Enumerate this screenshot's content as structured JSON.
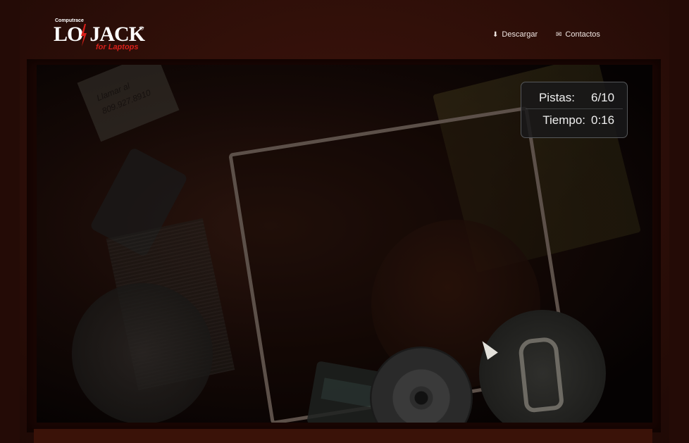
{
  "logo": {
    "small": "Computrace",
    "big_left": "LO",
    "big_right": "JACK",
    "subtitle": "for Laptops"
  },
  "nav": {
    "download": {
      "icon": "download-arrow-icon",
      "label": "Descargar"
    },
    "contact": {
      "icon": "envelope-icon",
      "label": "Contactos"
    }
  },
  "hud": {
    "clues_label": "Pistas:",
    "clues_value": "6/10",
    "time_label": "Tiempo:",
    "time_value": "0:16"
  },
  "scene": {
    "note_line1": "Llamar al",
    "note_line2": "809.927.8910"
  },
  "colors": {
    "background": "#2a0d08",
    "logo_accent": "#d8201a",
    "hud_bg": "#19191a"
  }
}
